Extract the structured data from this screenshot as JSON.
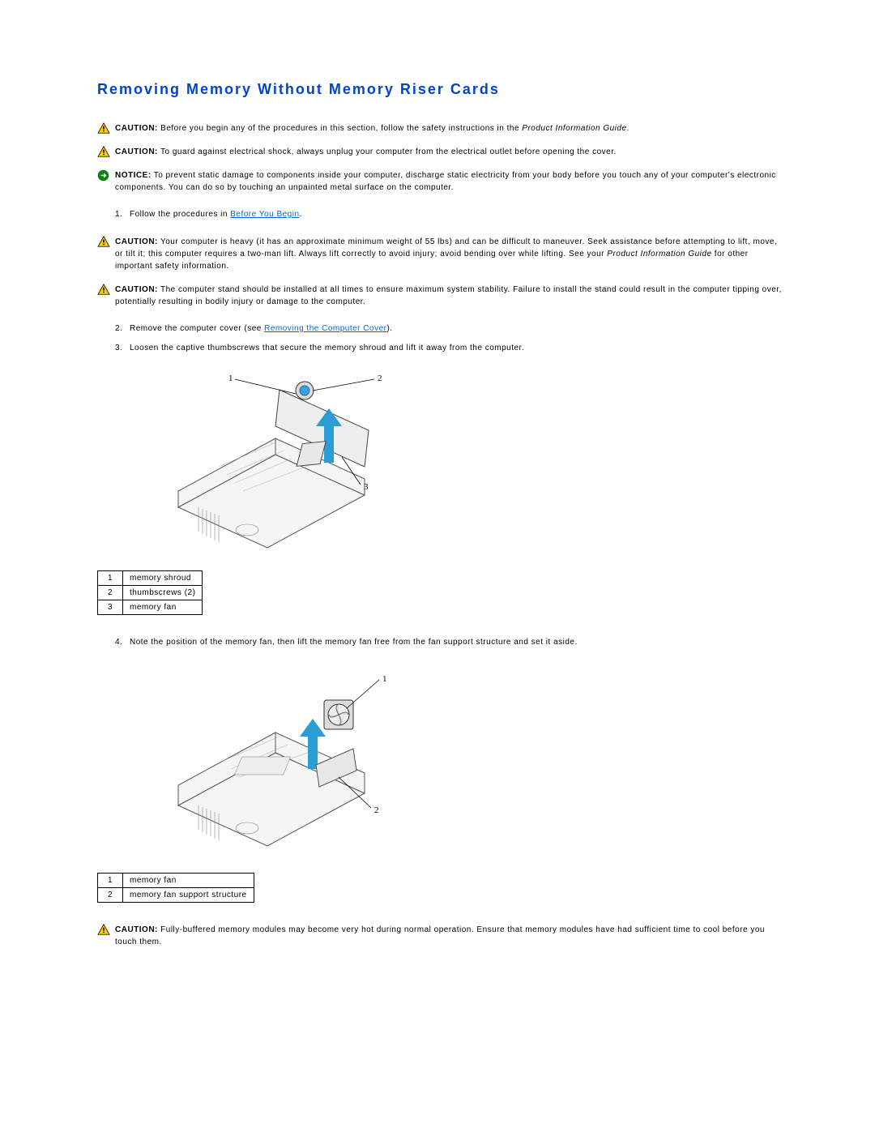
{
  "section_title": "Removing Memory Without Memory Riser Cards",
  "labels": {
    "caution": "CAUTION:",
    "notice": "NOTICE:"
  },
  "caution1_a": " Before you begin any of the procedures in this section, follow the safety instructions in the ",
  "caution1_b": "Product Information Guide",
  "caution1_c": ".",
  "caution2": " To guard against electrical shock, always unplug your computer from the electrical outlet before opening the cover.",
  "notice1": " To prevent static damage to components inside your computer, discharge static electricity from your body before you touch any of your computer's electronic components. You can do so by touching an unpainted metal surface on the computer.",
  "step1_a": "Follow the procedures in ",
  "step1_link": "Before You Begin",
  "step1_b": ".",
  "caution3_a": " Your computer is heavy (it has an approximate minimum weight of 55 lbs) and can be difficult to maneuver. Seek assistance before attempting to lift, move, or tilt it; this computer requires a two-man lift. Always lift correctly to avoid injury; avoid bending over while lifting. See your ",
  "caution3_b": "Product Information Guide",
  "caution3_c": " for other important safety information.",
  "caution4": " The computer stand should be installed at all times to ensure maximum system stability. Failure to install the stand could result in the computer tipping over, potentially resulting in bodily injury or damage to the computer.",
  "step2_a": "Remove the computer cover (see ",
  "step2_link": "Removing the Computer Cover",
  "step2_b": ").",
  "step3": "Loosen the captive thumbscrews that secure the memory shroud and lift it away from the computer.",
  "fig1": {
    "c1": "1",
    "c2": "2",
    "c3": "3"
  },
  "table1": {
    "r1n": "1",
    "r1t": "memory shroud",
    "r2n": "2",
    "r2t": "thumbscrews (2)",
    "r3n": "3",
    "r3t": "memory fan"
  },
  "step4": "Note the position of the memory fan, then lift the memory fan free from the fan support structure and set it aside.",
  "fig2": {
    "c1": "1",
    "c2": "2"
  },
  "table2": {
    "r1n": "1",
    "r1t": "memory fan",
    "r2n": "2",
    "r2t": "memory fan support structure"
  },
  "caution5": " Fully-buffered memory modules may become very hot during normal operation. Ensure that memory modules have had sufficient time to cool before you touch them."
}
